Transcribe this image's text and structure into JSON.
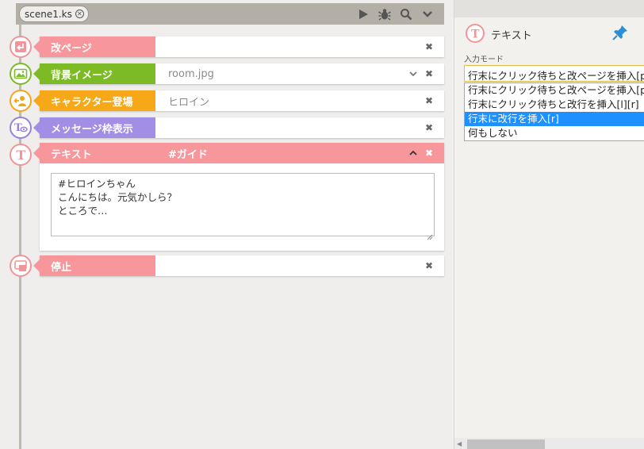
{
  "tab": {
    "filename": "scene1.ks"
  },
  "toolbar": {
    "icons": [
      "play-icon",
      "bug-icon",
      "search-icon",
      "chevron-down-icon"
    ]
  },
  "blocks": [
    {
      "label": "改ページ",
      "value": ""
    },
    {
      "label": "背景イメージ",
      "value": "room.jpg"
    },
    {
      "label": "キャラクター登場",
      "value": "ヒロイン"
    },
    {
      "label": "メッセージ枠表示",
      "value": ""
    },
    {
      "label": "テキスト",
      "value": "#ガイド",
      "text": "#ヒロインちゃん\nこんにちは。元気かしら？\nところで…"
    },
    {
      "label": "停止",
      "value": ""
    }
  ],
  "inspector": {
    "title": "テキスト",
    "mode_label": "入力モード",
    "selected_value": "行末にクリック待ちと改ページを挿入[p]",
    "options": [
      "行末にクリック待ちと改ページを挿入[p]",
      "行末にクリック待ちと改行を挿入[l][r]",
      "行末に改行を挿入[r]",
      "何もしない"
    ],
    "highlighted_option": "行末に改行を挿入[r]"
  },
  "colors": {
    "pink": "#f7979b",
    "green": "#7cbb26",
    "orange": "#f6a819",
    "purple": "#a38ee6",
    "highlight": "#1e90ff"
  }
}
